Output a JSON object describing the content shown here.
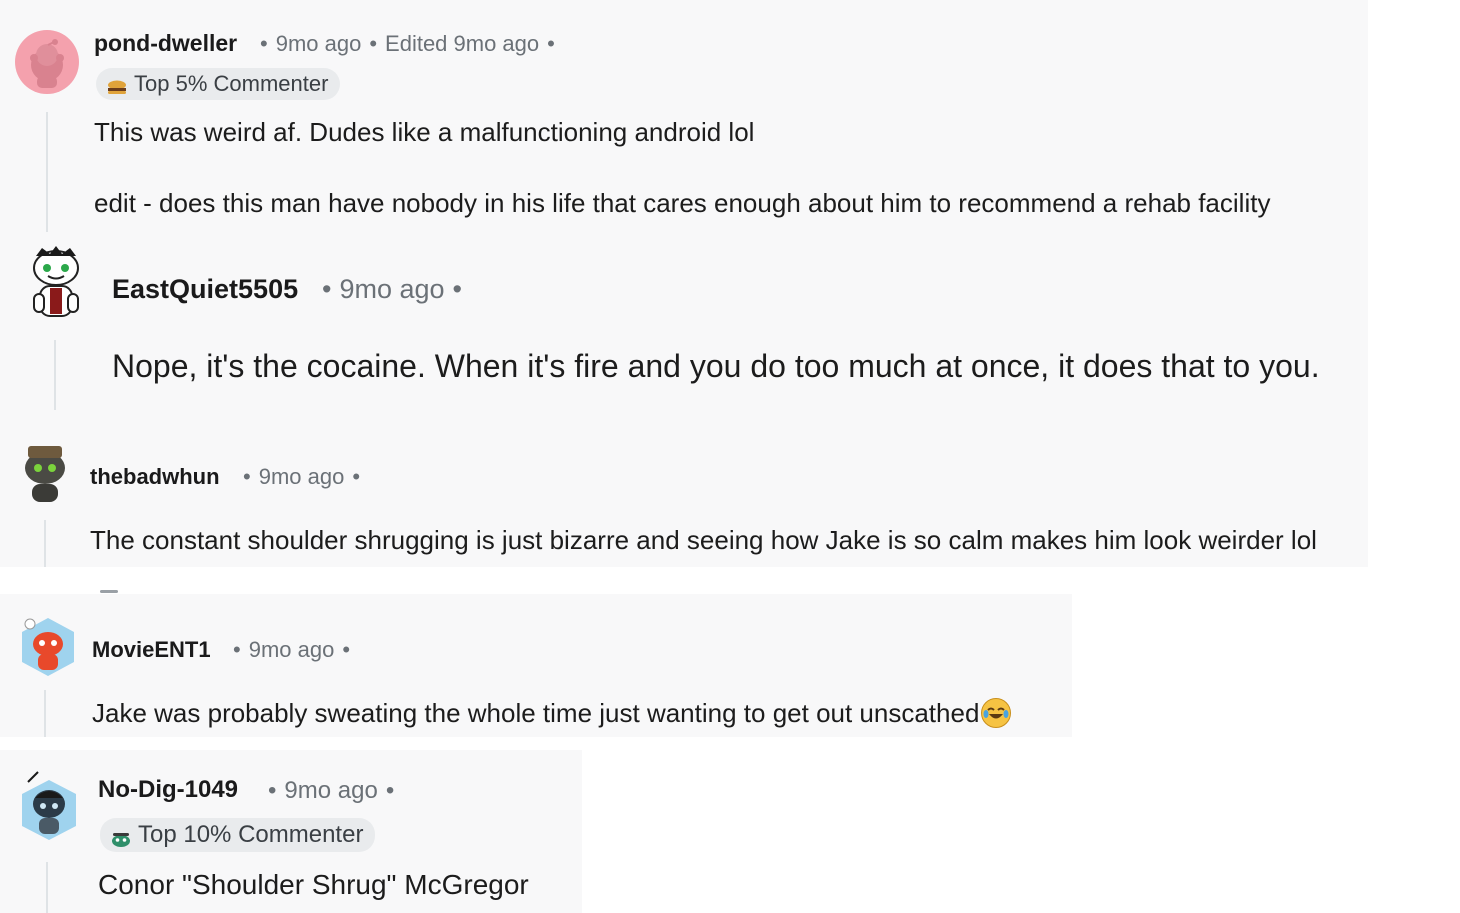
{
  "comments": [
    {
      "username": "pond-dweller",
      "time": "9mo ago",
      "edited": "Edited 9mo ago",
      "flair": "Top 5% Commenter",
      "body": "This was weird af. Dudes like a malfunctioning android lol",
      "body2": "edit - does this man have nobody in his life that cares enough about him to recommend a rehab facility"
    },
    {
      "username": "EastQuiet5505",
      "time": "9mo ago",
      "body": "Nope, it's the cocaine. When it's fire and you do too much at once, it does that to you."
    },
    {
      "username": "thebadwhun",
      "time": "9mo ago",
      "body": "The constant shoulder shrugging is just bizarre and seeing how Jake is so calm makes him look weirder lol"
    },
    {
      "username": "MovieENT1",
      "time": "9mo ago",
      "body": "Jake was probably sweating the whole time just wanting to get out unscathed",
      "emoji": "laughing-tears-emoji"
    },
    {
      "username": "No-Dig-1049",
      "time": "9mo ago",
      "flair": "Top 10% Commenter",
      "body": "Conor \"Shoulder Shrug\" McGregor"
    }
  ],
  "colors": {
    "panel_bg": "#f8f8f9",
    "meta_text": "#6b7177",
    "flair_bg": "#e9ebed",
    "thread_line": "#dfe3e6",
    "avatar_pink": "#f4a1ad"
  },
  "dot": "•"
}
